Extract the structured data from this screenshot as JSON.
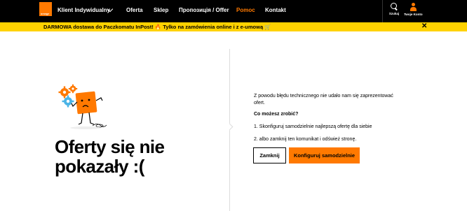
{
  "nav": {
    "logo_text": "orange",
    "items": [
      "Klient Indywidualny",
      "Oferta",
      "Sklep",
      "Пропозиція / Offer",
      "Pomoc",
      "Kontakt"
    ],
    "search_label": "Szukaj",
    "account_label": "Twoje Konto"
  },
  "promo": {
    "text": "DARMOWA dostawa do Paczkomatu InPost! 🔥 Tylko na zamówienia online i z e-umową 🛒",
    "close": "✕"
  },
  "error": {
    "title_line1": "Oferty się nie",
    "title_line2": "pokazały :(",
    "message_line1": "Z powodu błędu technicznego nie udało nam się zaprezentować",
    "message_line2": "ofert.",
    "question": "Co możesz zrobić?",
    "step1": "1. Skonfiguruj samodzielnie najlepszą ofertę dla siebie",
    "step2": "2. albo zamknij ten komunikat i odśwież stronę.",
    "close_button": "Zamknij",
    "configure_button": "Konfiguruj samodzielnie"
  },
  "colors": {
    "brand": "#ff7900",
    "promo_bg": "#ffd200",
    "nav_bg": "#000000",
    "gear_blue": "#4bb4e6"
  }
}
